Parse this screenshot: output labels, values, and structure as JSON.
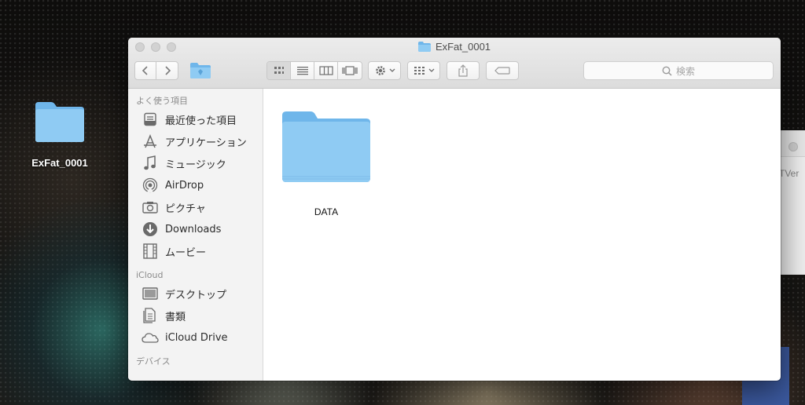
{
  "desktop": {
    "icon_label": "ExFat_0001"
  },
  "background_window": {
    "partial_text": "TVer"
  },
  "window": {
    "title": "ExFat_0001"
  },
  "toolbar": {
    "search_placeholder": "検索"
  },
  "sidebar": {
    "favorites_header": "よく使う項目",
    "favorites": [
      {
        "label": "最近使った項目",
        "icon": "recents-icon"
      },
      {
        "label": "アプリケーション",
        "icon": "applications-icon"
      },
      {
        "label": "ミュージック",
        "icon": "music-icon"
      },
      {
        "label": "AirDrop",
        "icon": "airdrop-icon"
      },
      {
        "label": "ピクチャ",
        "icon": "camera-icon"
      },
      {
        "label": "Downloads",
        "icon": "downloads-icon"
      },
      {
        "label": "ムービー",
        "icon": "film-icon"
      }
    ],
    "icloud_header": "iCloud",
    "icloud": [
      {
        "label": "デスクトップ",
        "icon": "desktop-icon"
      },
      {
        "label": "書類",
        "icon": "documents-icon"
      },
      {
        "label": "iCloud Drive",
        "icon": "cloud-icon"
      }
    ],
    "devices_header": "デバイス"
  },
  "content": {
    "items": [
      {
        "name": "DATA",
        "icon": "folder-icon"
      }
    ]
  },
  "colors": {
    "folder_blue": "#8cc8f2",
    "folder_tab": "#6fb6ea"
  }
}
